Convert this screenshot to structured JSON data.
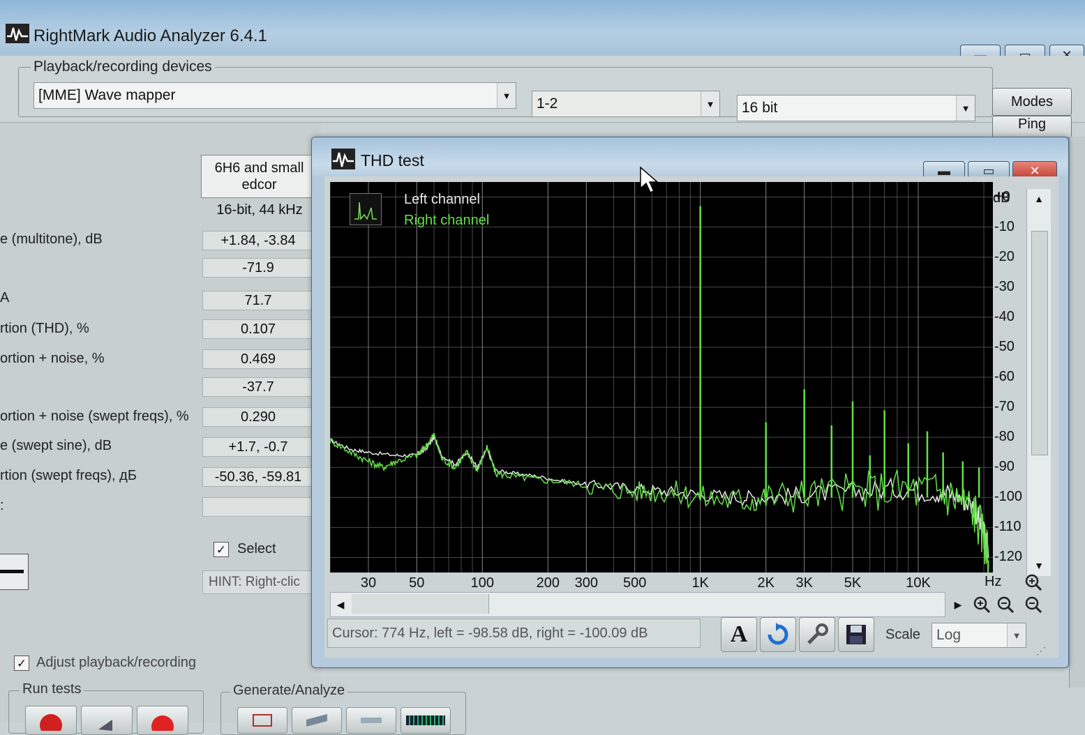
{
  "app": {
    "title": "RightMark Audio Analyzer 6.4.1"
  },
  "window_controls": {
    "minimize": "▬",
    "maximize": "▭",
    "close": "✕"
  },
  "devices": {
    "legend": "Playback/recording devices",
    "device": "[MME] Wave mapper",
    "channels": "1-2",
    "bits": "16 bit",
    "modes_label": "Modes",
    "ping_label": "Ping"
  },
  "results": {
    "column_header": "6H6 and small edcor",
    "format": "16-bit, 44 kHz",
    "rows": [
      {
        "label": "e (multitone), dB",
        "value": "+1.84, -3.84"
      },
      {
        "label": "",
        "value": "-71.9"
      },
      {
        "label": "A",
        "value": "71.7"
      },
      {
        "label": "rtion (THD), %",
        "value": "0.107"
      },
      {
        "label": "ortion + noise, %",
        "value": "0.469"
      },
      {
        "label": "",
        "value": "-37.7"
      },
      {
        "label": "ortion + noise (swept freqs), %",
        "value": "0.290"
      },
      {
        "label": "e (swept sine), dB",
        "value": "+1.7, -0.7"
      },
      {
        "label": "rtion (swept freqs), дБ",
        "value": "-50.36, -59.81"
      },
      {
        "label": ":",
        "value": ""
      }
    ],
    "select_label": "Select",
    "hint": "HINT: Right-clic",
    "adjust_label": "Adjust playback/recording",
    "run_tests_legend": "Run tests",
    "generate_legend": "Generate/Analyze"
  },
  "thd": {
    "title": "THD test",
    "legend_left": "Left channel",
    "legend_right": "Right channel",
    "status": "Cursor:  774 Hz,  left = -98.58 dB,  right = -100.09 dB",
    "scale_label": "Scale",
    "scale_value": "Log",
    "font_button": "A"
  },
  "chart_data": {
    "type": "line",
    "xlabel": "Hz",
    "ylabel": "dB",
    "x_scale": "log",
    "xlim": [
      20,
      22000
    ],
    "ylim": [
      -125,
      5
    ],
    "grid": true,
    "x_ticks": [
      {
        "label": "30",
        "value": 30
      },
      {
        "label": "50",
        "value": 50
      },
      {
        "label": "100",
        "value": 100
      },
      {
        "label": "200",
        "value": 200
      },
      {
        "label": "300",
        "value": 300
      },
      {
        "label": "500",
        "value": 500
      },
      {
        "label": "1K",
        "value": 1000
      },
      {
        "label": "2K",
        "value": 2000
      },
      {
        "label": "3K",
        "value": 3000
      },
      {
        "label": "5K",
        "value": 5000
      },
      {
        "label": "10K",
        "value": 10000
      }
    ],
    "y_ticks": [
      {
        "label": "+0",
        "value": 0
      },
      {
        "label": "-10",
        "value": -10
      },
      {
        "label": "-20",
        "value": -20
      },
      {
        "label": "-30",
        "value": -30
      },
      {
        "label": "-40",
        "value": -40
      },
      {
        "label": "-50",
        "value": -50
      },
      {
        "label": "-60",
        "value": -60
      },
      {
        "label": "-70",
        "value": -70
      },
      {
        "label": "-80",
        "value": -80
      },
      {
        "label": "-90",
        "value": -90
      },
      {
        "label": "-100",
        "value": -100
      },
      {
        "label": "-110",
        "value": -110
      },
      {
        "label": "-120",
        "value": -120
      }
    ],
    "series": [
      {
        "name": "Left channel",
        "color": "#e6e6e6",
        "points": [
          [
            20,
            -81
          ],
          [
            25,
            -84
          ],
          [
            30,
            -85
          ],
          [
            40,
            -86
          ],
          [
            50,
            -86
          ],
          [
            55,
            -84
          ],
          [
            60,
            -80
          ],
          [
            65,
            -86
          ],
          [
            75,
            -89
          ],
          [
            85,
            -85
          ],
          [
            95,
            -90
          ],
          [
            105,
            -84
          ],
          [
            115,
            -91
          ],
          [
            140,
            -92
          ],
          [
            180,
            -93
          ],
          [
            250,
            -95
          ],
          [
            350,
            -96
          ],
          [
            500,
            -97
          ],
          [
            700,
            -98
          ],
          [
            1000,
            -99
          ],
          [
            1500,
            -100
          ],
          [
            2000,
            -100
          ],
          [
            3000,
            -99
          ],
          [
            5000,
            -98
          ],
          [
            8000,
            -97
          ],
          [
            12000,
            -98
          ],
          [
            15000,
            -99
          ],
          [
            18000,
            -103
          ],
          [
            20000,
            -112
          ],
          [
            21000,
            -120
          ]
        ]
      },
      {
        "name": "Right channel",
        "color": "#66e04a",
        "points": [
          [
            20,
            -81
          ],
          [
            25,
            -85
          ],
          [
            30,
            -88
          ],
          [
            35,
            -90
          ],
          [
            40,
            -88
          ],
          [
            50,
            -86
          ],
          [
            55,
            -83
          ],
          [
            60,
            -79
          ],
          [
            65,
            -87
          ],
          [
            75,
            -90
          ],
          [
            85,
            -85
          ],
          [
            95,
            -91
          ],
          [
            105,
            -83
          ],
          [
            115,
            -92
          ],
          [
            140,
            -93
          ],
          [
            180,
            -94
          ],
          [
            250,
            -95
          ],
          [
            350,
            -97
          ],
          [
            500,
            -98
          ],
          [
            700,
            -98
          ],
          [
            1000,
            -100
          ],
          [
            1500,
            -101
          ],
          [
            2000,
            -100
          ],
          [
            3000,
            -99
          ],
          [
            5000,
            -98
          ],
          [
            8000,
            -97
          ],
          [
            12000,
            -98
          ],
          [
            15000,
            -100
          ],
          [
            18000,
            -104
          ],
          [
            20000,
            -113
          ],
          [
            21000,
            -121
          ]
        ]
      }
    ],
    "peaks": [
      {
        "freq": 1000,
        "db": -3
      },
      {
        "freq": 2000,
        "db": -75
      },
      {
        "freq": 3000,
        "db": -64
      },
      {
        "freq": 4000,
        "db": -76
      },
      {
        "freq": 5000,
        "db": -68
      },
      {
        "freq": 6000,
        "db": -86
      },
      {
        "freq": 7000,
        "db": -71
      },
      {
        "freq": 9000,
        "db": -82
      },
      {
        "freq": 11000,
        "db": -78
      },
      {
        "freq": 13000,
        "db": -85
      },
      {
        "freq": 16000,
        "db": -88
      },
      {
        "freq": 19000,
        "db": -90
      }
    ]
  }
}
